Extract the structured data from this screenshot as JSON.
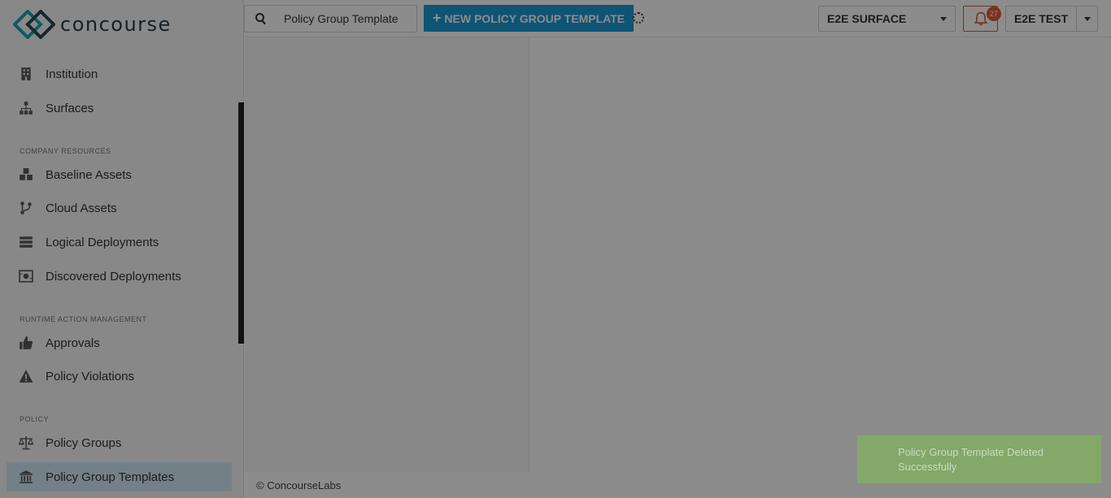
{
  "app": {
    "logo_text": "concourse"
  },
  "sidebar": {
    "items_top": [
      {
        "label": "Institution",
        "icon": "building-icon"
      },
      {
        "label": "Surfaces",
        "icon": "sitemap-icon"
      }
    ],
    "sections": [
      {
        "title": "COMPANY RESOURCES",
        "items": [
          {
            "label": "Baseline Assets",
            "icon": "cubes-icon"
          },
          {
            "label": "Cloud Assets",
            "icon": "code-branch-icon"
          },
          {
            "label": "Logical Deployments",
            "icon": "server-icon"
          },
          {
            "label": "Discovered Deployments",
            "icon": "search-deploy-icon"
          }
        ]
      },
      {
        "title": "RUNTIME ACTION MANAGEMENT",
        "items": [
          {
            "label": "Approvals",
            "icon": "thumbs-up-icon"
          },
          {
            "label": "Policy Violations",
            "icon": "warning-icon"
          }
        ]
      },
      {
        "title": "POLICY",
        "items": [
          {
            "label": "Policy Groups",
            "icon": "balance-scale-icon"
          },
          {
            "label": "Policy Group Templates",
            "icon": "institution-icon",
            "active": true
          }
        ]
      }
    ]
  },
  "header": {
    "search_value": "Policy Group Template",
    "new_button_label": "NEW POLICY GROUP TEMPLATE",
    "surface_select": "E2E SURFACE",
    "notification_count": "27",
    "user_name": "E2E TEST"
  },
  "footer": {
    "copyright": "© ConcourseLabs"
  },
  "toast": {
    "message": "Policy Group Template Deleted Successfully"
  },
  "colors": {
    "accent": "#1a9ad6",
    "active_item": "#d4e9f7",
    "alert": "#e05a3a",
    "toast": "#83a86a"
  }
}
